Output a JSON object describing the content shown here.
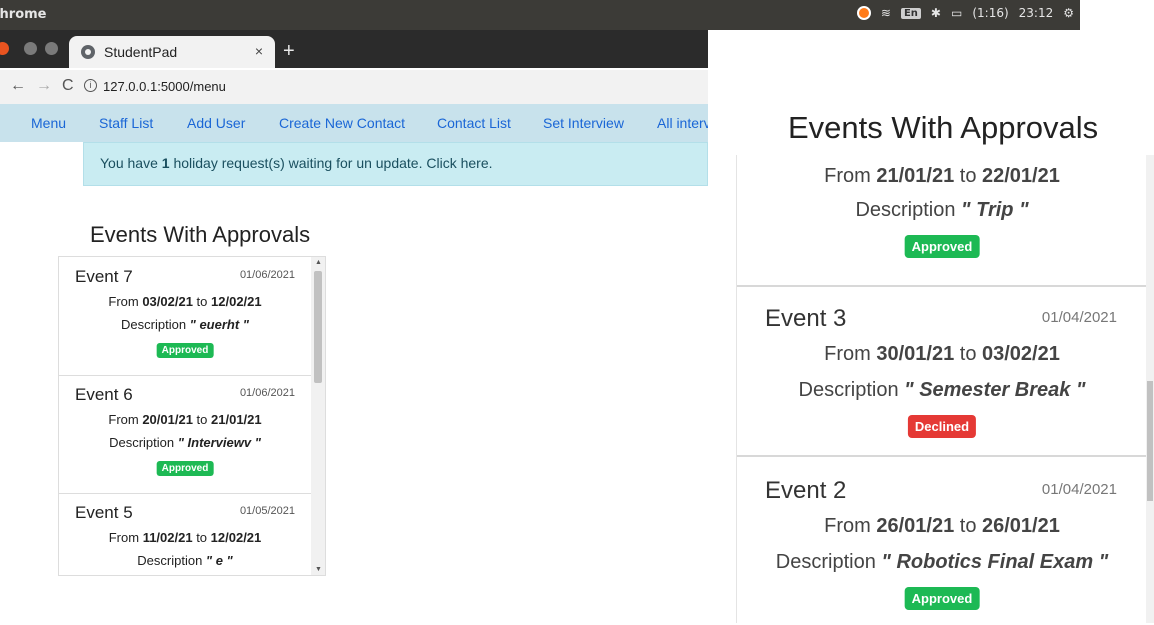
{
  "os_bar": {
    "app_name": "Chrome",
    "battery": "(1:16)",
    "time": "23:12",
    "lang": "En"
  },
  "tab": {
    "title": "StudentPad",
    "close": "×",
    "new": "+"
  },
  "address": {
    "url": "127.0.0.1:5000/menu"
  },
  "nav": [
    "Menu",
    "Staff List",
    "Add User",
    "Create New Contact",
    "Contact List",
    "Set Interview",
    "All intervi"
  ],
  "alert": {
    "prefix": "You have ",
    "count": "1",
    "suffix": " holiday request(s) waiting for un update. Click here."
  },
  "left_panel": {
    "heading": "Events With Approvals",
    "events": [
      {
        "name": "Event 7",
        "date": "01/06/2021",
        "from": "03/02/21",
        "to": "12/02/21",
        "description": "euerht",
        "status": "Approved"
      },
      {
        "name": "Event 6",
        "date": "01/06/2021",
        "from": "20/01/21",
        "to": "21/01/21",
        "description": "Interviewv",
        "status": "Approved"
      },
      {
        "name": "Event 5",
        "date": "01/05/2021",
        "from": "11/02/21",
        "to": "12/02/21",
        "description": "e",
        "status": ""
      }
    ]
  },
  "right_panel": {
    "heading": "Events With Approvals",
    "partial_event": {
      "from": "21/01/21",
      "to": "22/01/21",
      "description": "Trip",
      "status": "Approved"
    },
    "events": [
      {
        "name": "Event 3",
        "date": "01/04/2021",
        "from": "30/01/21",
        "to": "03/02/21",
        "description": "Semester Break",
        "status": "Declined"
      },
      {
        "name": "Event 2",
        "date": "01/04/2021",
        "from": "26/01/21",
        "to": "26/01/21",
        "description": "Robotics Final Exam",
        "status": "Approved"
      }
    ]
  },
  "labels": {
    "from": "From ",
    "to": " to ",
    "description": "Description ",
    "quote_open": "\" ",
    "quote_close": " \""
  },
  "colors": {
    "approved": "#1db954",
    "declined": "#e53935",
    "nav_bg": "#c8e2ec",
    "alert_bg": "#c9ecf2"
  }
}
